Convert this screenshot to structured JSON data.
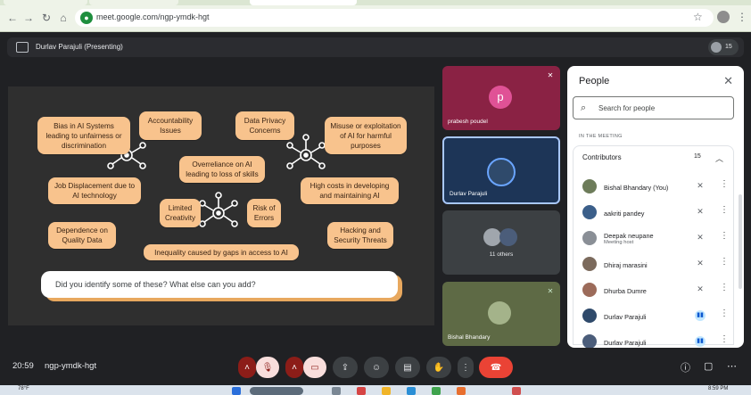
{
  "browser": {
    "url": "meet.google.com/ngp-ymdk-hgt"
  },
  "meeting": {
    "presenter_label": "Durlav Parajuli (Presenting)",
    "participant_count": "15",
    "clock": "20:59",
    "code": "ngp-ymdk-hgt"
  },
  "slide": {
    "bubbles": [
      "Bias in AI Systems leading to unfairness or discrimination",
      "Accountability Issues",
      "Data Privacy Concerns",
      "Misuse or exploitation of AI for harmful purposes",
      "Overreliance on AI leading to loss of skills",
      "Job Displacement due to AI technology",
      "High costs in developing and maintaining AI",
      "Limited Creativity",
      "Risk of Errors",
      "Dependence on Quality Data",
      "Hacking and Security Threats",
      "Inequality caused by gaps in access to AI"
    ],
    "question": "Did you identify some of these? What else can you add?"
  },
  "tiles": {
    "prabesh": {
      "initial": "p",
      "name": "prabesh poudel"
    },
    "durlav": {
      "name": "Durlav Parajuli"
    },
    "others": {
      "label": "11 others"
    },
    "bishal": {
      "name": "Bishal Bhandary"
    }
  },
  "people_panel": {
    "title": "People",
    "search_placeholder": "Search for people",
    "section_label": "IN THE MEETING",
    "group_label": "Contributors",
    "group_count": "15",
    "participants": [
      {
        "name": "Bishal Bhandary (You)",
        "role": "",
        "avatar_color": "#6d7c5a"
      },
      {
        "name": "aakriti pandey",
        "role": "",
        "avatar_color": "#3b5f8a"
      },
      {
        "name": "Deepak neupane",
        "role": "Meeting host",
        "avatar_color": "#8a8f96"
      },
      {
        "name": "Dhiraj marasini",
        "role": "",
        "avatar_color": "#7b6a5c"
      },
      {
        "name": "Dhurba Dumre",
        "role": "",
        "avatar_color": "#9c6b5a"
      },
      {
        "name": "Durlav Parajuli",
        "role": "",
        "avatar_color": "#2f4a6b"
      },
      {
        "name": "Durlav Parajuli",
        "role": "",
        "avatar_color": "#4b5d7a"
      }
    ]
  },
  "taskbar": {
    "weather": "78°F",
    "time": "8:59 PM"
  },
  "colors": {
    "accent_bubble": "#f8c38d",
    "end_call": "#ea4335",
    "tile_prabesh": "#8a2244",
    "avatar_p": "#e05296"
  }
}
